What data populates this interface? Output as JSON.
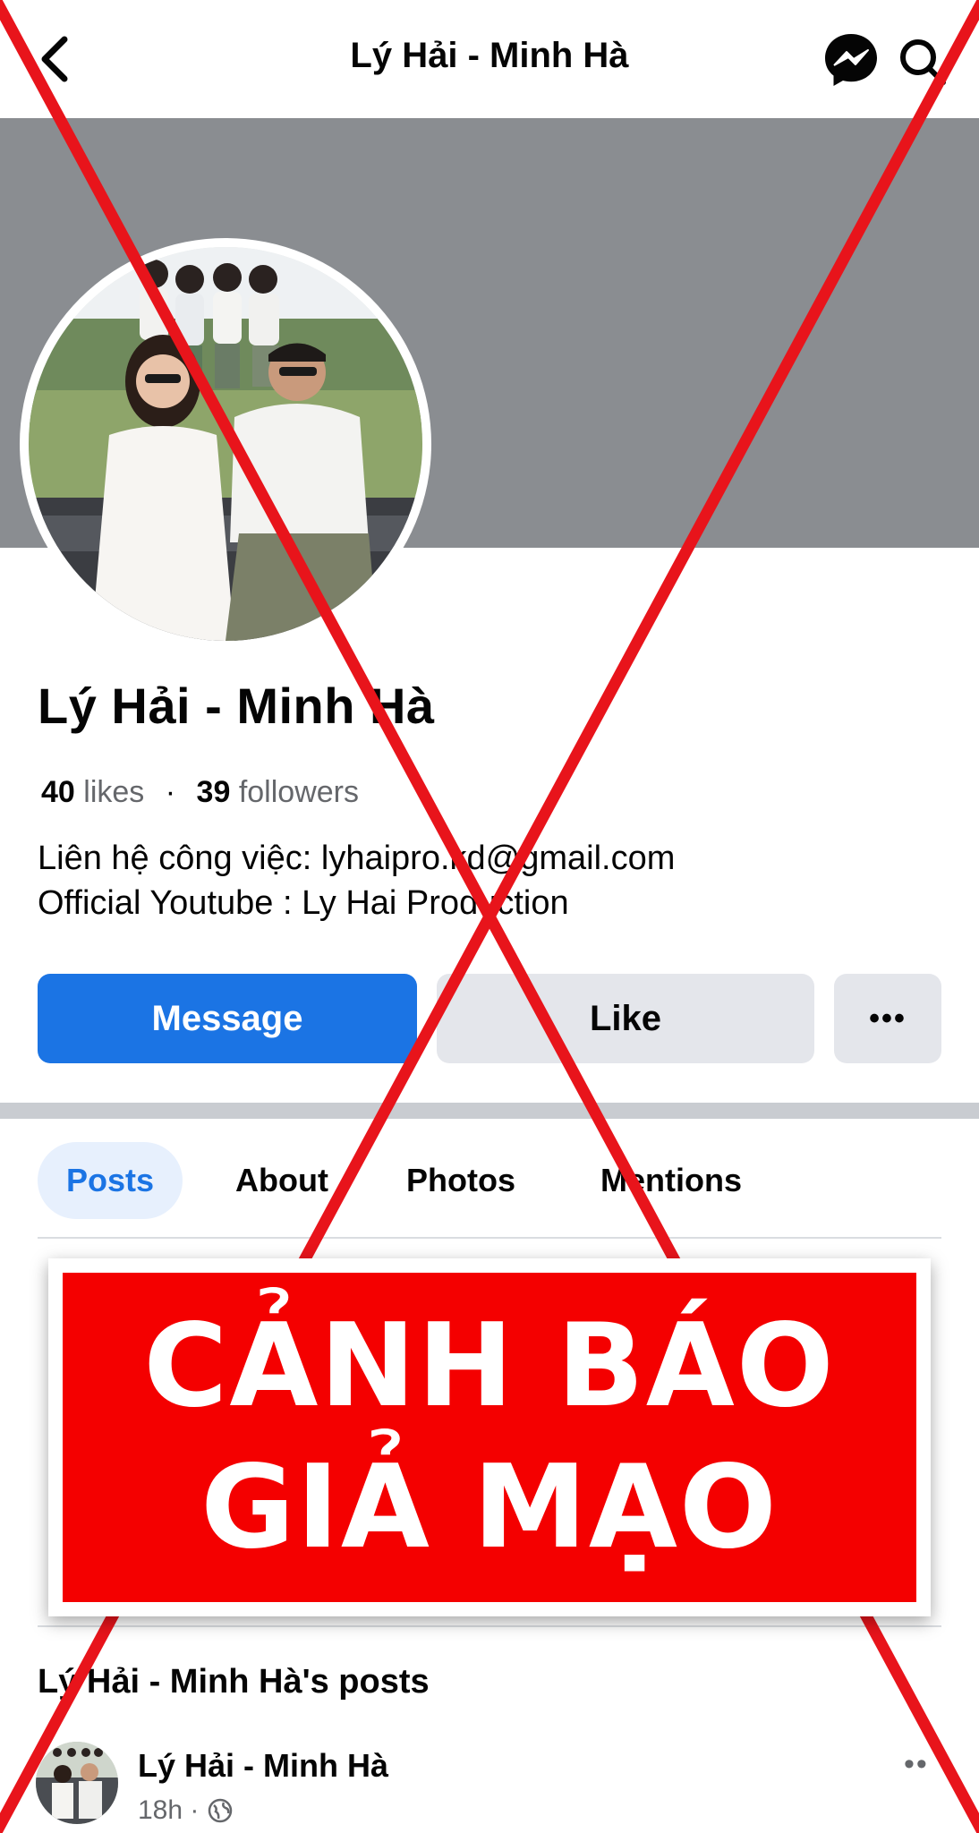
{
  "header": {
    "title": "Lý Hải - Minh Hà"
  },
  "profile": {
    "name": "Lý Hải - Minh Hà",
    "likes_count": "40",
    "likes_label": "likes",
    "followers_count": "39",
    "followers_label": "followers",
    "bio_line_1": "Liên hệ công việc: lyhaipro.kd@gmail.com",
    "bio_line_2": "Official Youtube : Ly Hai Production"
  },
  "actions": {
    "message": "Message",
    "like": "Like",
    "more": "•••"
  },
  "tabs": [
    {
      "label": "Posts",
      "active": true
    },
    {
      "label": "About",
      "active": false
    },
    {
      "label": "Photos",
      "active": false
    },
    {
      "label": "Mentions",
      "active": false
    }
  ],
  "posts_section": {
    "title": "Lý Hải - Minh Hà's posts"
  },
  "post": {
    "author": "Lý Hải - Minh Hà",
    "time": "18h ·",
    "more": "••"
  },
  "warning": {
    "line_1": "CẢNH BÁO",
    "line_2": "GIẢ MẠO"
  },
  "colors": {
    "brand_blue": "#1b74e4",
    "warning_red": "#f40000",
    "cross_red": "#e8141b",
    "cover_gray": "#8a8d91"
  },
  "icons": [
    "back-icon",
    "messenger-icon",
    "search-icon",
    "globe-icon"
  ]
}
